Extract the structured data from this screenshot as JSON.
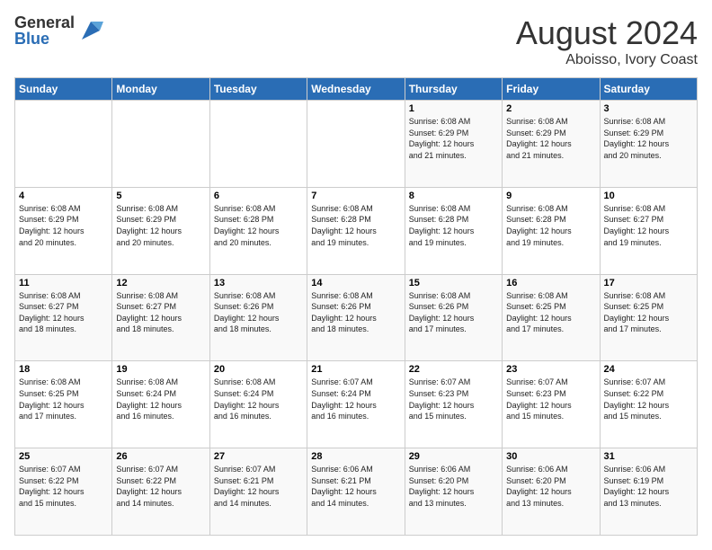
{
  "logo": {
    "general": "General",
    "blue": "Blue"
  },
  "header": {
    "month_year": "August 2024",
    "location": "Aboisso, Ivory Coast"
  },
  "weekdays": [
    "Sunday",
    "Monday",
    "Tuesday",
    "Wednesday",
    "Thursday",
    "Friday",
    "Saturday"
  ],
  "weeks": [
    [
      {
        "day": "",
        "info": ""
      },
      {
        "day": "",
        "info": ""
      },
      {
        "day": "",
        "info": ""
      },
      {
        "day": "",
        "info": ""
      },
      {
        "day": "1",
        "info": "Sunrise: 6:08 AM\nSunset: 6:29 PM\nDaylight: 12 hours\nand 21 minutes."
      },
      {
        "day": "2",
        "info": "Sunrise: 6:08 AM\nSunset: 6:29 PM\nDaylight: 12 hours\nand 21 minutes."
      },
      {
        "day": "3",
        "info": "Sunrise: 6:08 AM\nSunset: 6:29 PM\nDaylight: 12 hours\nand 20 minutes."
      }
    ],
    [
      {
        "day": "4",
        "info": "Sunrise: 6:08 AM\nSunset: 6:29 PM\nDaylight: 12 hours\nand 20 minutes."
      },
      {
        "day": "5",
        "info": "Sunrise: 6:08 AM\nSunset: 6:29 PM\nDaylight: 12 hours\nand 20 minutes."
      },
      {
        "day": "6",
        "info": "Sunrise: 6:08 AM\nSunset: 6:28 PM\nDaylight: 12 hours\nand 20 minutes."
      },
      {
        "day": "7",
        "info": "Sunrise: 6:08 AM\nSunset: 6:28 PM\nDaylight: 12 hours\nand 19 minutes."
      },
      {
        "day": "8",
        "info": "Sunrise: 6:08 AM\nSunset: 6:28 PM\nDaylight: 12 hours\nand 19 minutes."
      },
      {
        "day": "9",
        "info": "Sunrise: 6:08 AM\nSunset: 6:28 PM\nDaylight: 12 hours\nand 19 minutes."
      },
      {
        "day": "10",
        "info": "Sunrise: 6:08 AM\nSunset: 6:27 PM\nDaylight: 12 hours\nand 19 minutes."
      }
    ],
    [
      {
        "day": "11",
        "info": "Sunrise: 6:08 AM\nSunset: 6:27 PM\nDaylight: 12 hours\nand 18 minutes."
      },
      {
        "day": "12",
        "info": "Sunrise: 6:08 AM\nSunset: 6:27 PM\nDaylight: 12 hours\nand 18 minutes."
      },
      {
        "day": "13",
        "info": "Sunrise: 6:08 AM\nSunset: 6:26 PM\nDaylight: 12 hours\nand 18 minutes."
      },
      {
        "day": "14",
        "info": "Sunrise: 6:08 AM\nSunset: 6:26 PM\nDaylight: 12 hours\nand 18 minutes."
      },
      {
        "day": "15",
        "info": "Sunrise: 6:08 AM\nSunset: 6:26 PM\nDaylight: 12 hours\nand 17 minutes."
      },
      {
        "day": "16",
        "info": "Sunrise: 6:08 AM\nSunset: 6:25 PM\nDaylight: 12 hours\nand 17 minutes."
      },
      {
        "day": "17",
        "info": "Sunrise: 6:08 AM\nSunset: 6:25 PM\nDaylight: 12 hours\nand 17 minutes."
      }
    ],
    [
      {
        "day": "18",
        "info": "Sunrise: 6:08 AM\nSunset: 6:25 PM\nDaylight: 12 hours\nand 17 minutes."
      },
      {
        "day": "19",
        "info": "Sunrise: 6:08 AM\nSunset: 6:24 PM\nDaylight: 12 hours\nand 16 minutes."
      },
      {
        "day": "20",
        "info": "Sunrise: 6:08 AM\nSunset: 6:24 PM\nDaylight: 12 hours\nand 16 minutes."
      },
      {
        "day": "21",
        "info": "Sunrise: 6:07 AM\nSunset: 6:24 PM\nDaylight: 12 hours\nand 16 minutes."
      },
      {
        "day": "22",
        "info": "Sunrise: 6:07 AM\nSunset: 6:23 PM\nDaylight: 12 hours\nand 15 minutes."
      },
      {
        "day": "23",
        "info": "Sunrise: 6:07 AM\nSunset: 6:23 PM\nDaylight: 12 hours\nand 15 minutes."
      },
      {
        "day": "24",
        "info": "Sunrise: 6:07 AM\nSunset: 6:22 PM\nDaylight: 12 hours\nand 15 minutes."
      }
    ],
    [
      {
        "day": "25",
        "info": "Sunrise: 6:07 AM\nSunset: 6:22 PM\nDaylight: 12 hours\nand 15 minutes."
      },
      {
        "day": "26",
        "info": "Sunrise: 6:07 AM\nSunset: 6:22 PM\nDaylight: 12 hours\nand 14 minutes."
      },
      {
        "day": "27",
        "info": "Sunrise: 6:07 AM\nSunset: 6:21 PM\nDaylight: 12 hours\nand 14 minutes."
      },
      {
        "day": "28",
        "info": "Sunrise: 6:06 AM\nSunset: 6:21 PM\nDaylight: 12 hours\nand 14 minutes."
      },
      {
        "day": "29",
        "info": "Sunrise: 6:06 AM\nSunset: 6:20 PM\nDaylight: 12 hours\nand 13 minutes."
      },
      {
        "day": "30",
        "info": "Sunrise: 6:06 AM\nSunset: 6:20 PM\nDaylight: 12 hours\nand 13 minutes."
      },
      {
        "day": "31",
        "info": "Sunrise: 6:06 AM\nSunset: 6:19 PM\nDaylight: 12 hours\nand 13 minutes."
      }
    ]
  ]
}
